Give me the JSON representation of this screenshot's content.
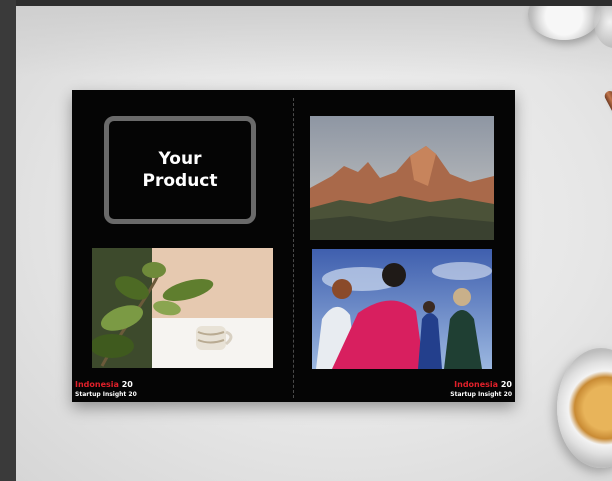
{
  "booklet": {
    "product_placeholder": "Your\nProduct",
    "brand_left": {
      "name": "Indonesia",
      "year_a": "20",
      "tagline": "Startup Insight",
      "year_b": "20"
    },
    "brand_right": {
      "name": "Indonesia",
      "year_a": "20",
      "tagline": "Startup Insight",
      "year_b": "20"
    }
  },
  "colors": {
    "page_background": "#050505",
    "brand_red": "#e0202a",
    "frame_gray": "#6a6a6a",
    "editor_chrome": "#3a3a3a"
  },
  "icons": [
    "coffee-cup-icon",
    "pen-icon",
    "glass-icon"
  ]
}
